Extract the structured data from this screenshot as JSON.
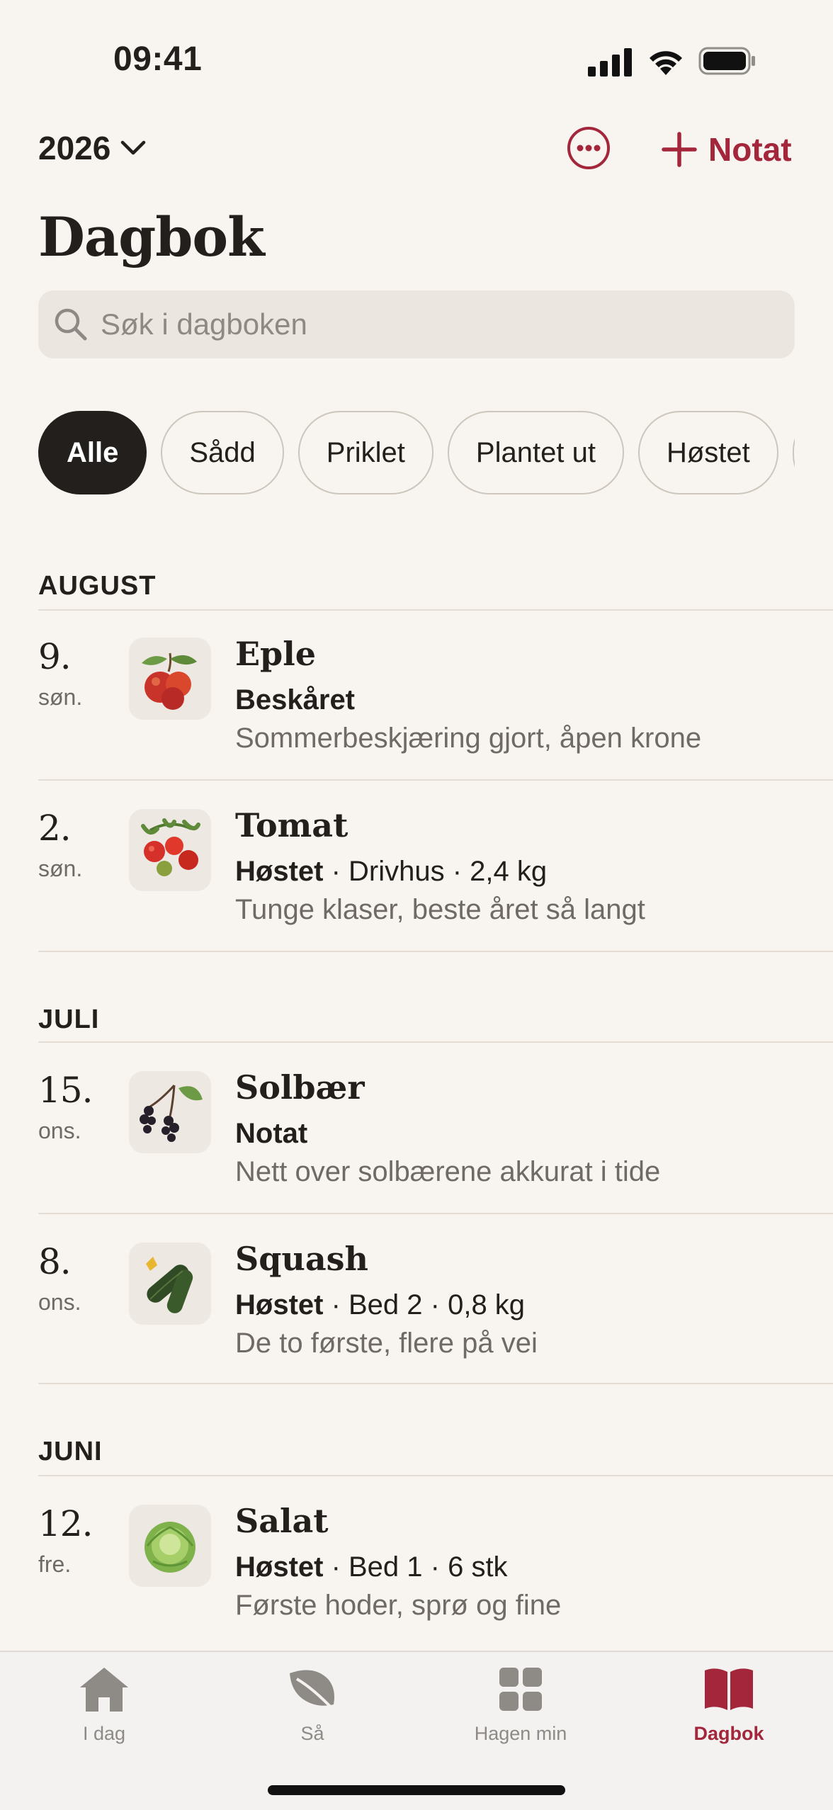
{
  "status_bar": {
    "time": "09:41"
  },
  "header": {
    "year": "2026",
    "add_note_label": "Notat",
    "title": "Dagbok"
  },
  "search": {
    "placeholder": "Søk i dagboken"
  },
  "filters": [
    {
      "label": "Alle",
      "active": true
    },
    {
      "label": "Sådd",
      "active": false
    },
    {
      "label": "Priklet",
      "active": false
    },
    {
      "label": "Plantet ut",
      "active": false
    },
    {
      "label": "Høstet",
      "active": false
    }
  ],
  "sections": [
    {
      "month": "AUGUST",
      "entries": [
        {
          "day": "9.",
          "weekday": "søn.",
          "plant": "Eple",
          "icon": "apple-icon",
          "action": "Beskåret",
          "details": "",
          "note": "Sommerbeskjæring gjort, åpen krone"
        },
        {
          "day": "2.",
          "weekday": "søn.",
          "plant": "Tomat",
          "icon": "tomato-icon",
          "action": "Høstet",
          "details": " · Drivhus · 2,4 kg",
          "note": "Tunge klaser, beste året så langt"
        }
      ]
    },
    {
      "month": "JULI",
      "entries": [
        {
          "day": "15.",
          "weekday": "ons.",
          "plant": "Solbær",
          "icon": "blackcurrant-icon",
          "action": "Notat",
          "details": "",
          "note": "Nett over solbærene akkurat i tide"
        },
        {
          "day": "8.",
          "weekday": "ons.",
          "plant": "Squash",
          "icon": "zucchini-icon",
          "action": "Høstet",
          "details": " · Bed 2 · 0,8 kg",
          "note": "De to første, flere på vei"
        }
      ]
    },
    {
      "month": "JUNI",
      "entries": [
        {
          "day": "12.",
          "weekday": "fre.",
          "plant": "Salat",
          "icon": "lettuce-icon",
          "action": "Høstet",
          "details": " · Bed 1 · 6 stk",
          "note": "Første hoder, sprø og fine"
        }
      ]
    }
  ],
  "tabbar": [
    {
      "label": "I dag",
      "icon": "home-icon",
      "active": false
    },
    {
      "label": "Så",
      "icon": "leaf-icon",
      "active": false
    },
    {
      "label": "Hagen min",
      "icon": "grid-icon",
      "active": false
    },
    {
      "label": "Dagbok",
      "icon": "book-icon",
      "active": true
    }
  ],
  "colors": {
    "accent": "#a3263a",
    "background": "#f8f4ef",
    "text": "#231f1c",
    "muted": "#6f6a65"
  }
}
